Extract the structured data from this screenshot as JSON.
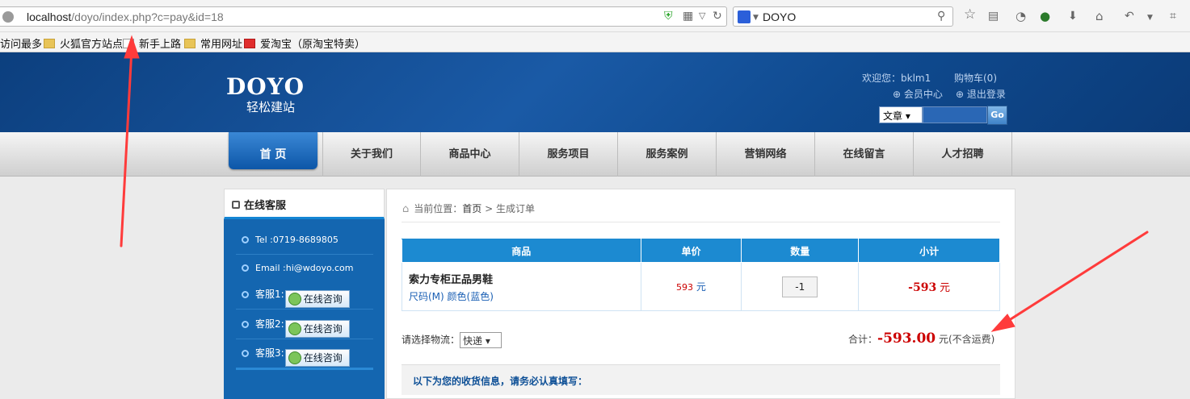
{
  "browser": {
    "url_host": "localhost",
    "url_path": "/doyo/index.php?c=pay&id=18",
    "search_query": "DOYO",
    "bookmarks": [
      "访问最多",
      "火狐官方站点",
      "新手上路",
      "常用网址",
      "爱淘宝（原淘宝特卖）"
    ]
  },
  "site": {
    "logo_text": "DOYO",
    "logo_slogan": "轻松建站",
    "welcome": "欢迎您：bklm1",
    "cart_link": "购物车(0)",
    "member_center": "会员中心",
    "logout": "退出登录",
    "search_category": "文章",
    "search_go": "Go"
  },
  "nav": {
    "home": "首 页",
    "items": [
      "关于我们",
      "商品中心",
      "服务项目",
      "服务案例",
      "营销网络",
      "在线留言",
      "人才招聘"
    ]
  },
  "sidebar": {
    "title": "在线客服",
    "tel": "Tel :0719-8689805",
    "email": "Email :hi@wdoyo.com",
    "services": [
      {
        "label": "客服1:",
        "button": "在线咨询"
      },
      {
        "label": "客服2:",
        "button": "在线咨询"
      },
      {
        "label": "客服3:",
        "button": "在线咨询"
      }
    ]
  },
  "breadcrumb": {
    "prefix": "当前位置：",
    "home": "首页",
    "sep": ">",
    "current": "生成订单"
  },
  "cart": {
    "headers": [
      "商品",
      "单价",
      "数量",
      "小计"
    ],
    "items": [
      {
        "name": "索力专柜正品男鞋",
        "attrs": "尺码(M) 颜色(蓝色)",
        "price": "593",
        "price_unit": "元",
        "qty": "-1",
        "subtotal": "-593",
        "subtotal_unit": "元"
      }
    ]
  },
  "shipping": {
    "label": "请选择物流：",
    "selected": "快递"
  },
  "summary": {
    "label": "合计：",
    "total": "-593.00",
    "unit": "元(不含运费)"
  },
  "notice": "以下为您的收货信息，请务必认真填写：",
  "colors": {
    "header_blue": "#0f4a8f",
    "accent_blue": "#1c8ad1",
    "price_red": "#cc0000",
    "annotation_red": "#ff3b3b"
  }
}
